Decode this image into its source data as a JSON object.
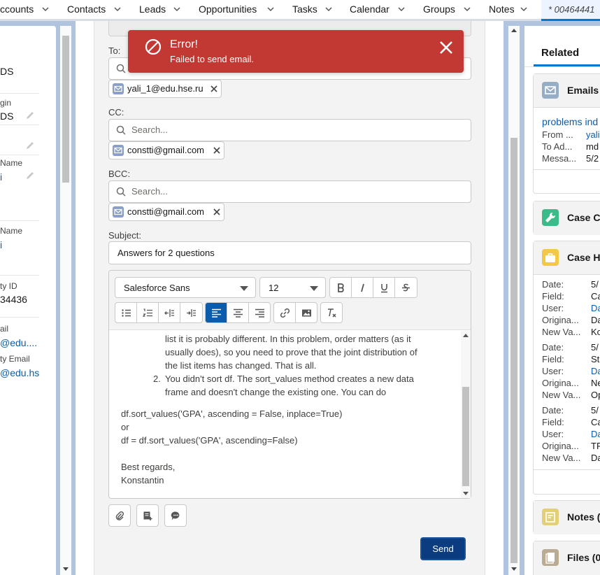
{
  "nav": {
    "items": [
      "ccounts",
      "Contacts",
      "Leads",
      "Opportunities",
      "Tasks",
      "Calendar",
      "Groups",
      "Notes"
    ],
    "active_tab": "* 00464441"
  },
  "left_panel": {
    "val_top": "DS",
    "label_login": "gin",
    "val_login": "DS",
    "label_name": "Name",
    "link_name": "i",
    "label_name2": "Name",
    "link_name2": "i",
    "label_id": "ty ID",
    "val_id": "34436",
    "label_email": "ail",
    "link_email": "@edu....",
    "label_email2": "ty Email",
    "link_email2": "@edu.hs"
  },
  "email": {
    "to_label": "To:",
    "cc_label": "CC:",
    "bcc_label": "BCC:",
    "search_placeholder": "Search...",
    "to_pill": "yali_1@edu.hse.ru",
    "cc_pill": "constti@gmail.com",
    "bcc_pill": "constti@gmail.com",
    "subject_label": "Subject:",
    "subject_value": "Answers for 2 questions",
    "font_family": "Salesforce Sans",
    "font_size": "12",
    "body": {
      "line1": "list it is probably different. In this problem, order matters (as it",
      "line2": "usually does), so you need to prove that the joint distribution of",
      "line3": "the list items has changed. That is all.",
      "item2_num": "2.",
      "line4": "You didn't sort df. The sort_values method creates a new data",
      "line5": "frame and doesn't change the existing one. You can do",
      "code1": "df.sort_values('GPA', ascending = False, inplace=True)",
      "or": "or",
      "code2": "df = df.sort_values('GPA', ascending=False)",
      "regards": "Best regards,",
      "name": "Konstantin"
    },
    "send_label": "Send"
  },
  "toast": {
    "title": "Error!",
    "message": "Failed to send email."
  },
  "right_panel": {
    "tab": "Related",
    "emails_title": "Emails",
    "email_link": "problems ind",
    "email_rows": [
      {
        "k": "From ...",
        "v": "yali"
      },
      {
        "k": "To Ad...",
        "v": "md"
      },
      {
        "k": "Messa...",
        "v": "5/2"
      }
    ],
    "case_comments_title": "Case Co",
    "case_history_title": "Case H",
    "history": [
      {
        "date": "5/",
        "field": "Ca",
        "user": "Da",
        "orig": "Da",
        "newv": "Ko"
      },
      {
        "date": "5/",
        "field": "Sta",
        "user": "Da",
        "orig": "Ne",
        "newv": "Op"
      },
      {
        "date": "5/",
        "field": "Ca",
        "user": "Da",
        "orig": "TF",
        "newv": "Da"
      }
    ],
    "history_labels": {
      "date": "Date:",
      "field": "Field:",
      "user": "User:",
      "orig": "Origina...",
      "newv": "New Va..."
    },
    "notes_title": "Notes (",
    "files_title": "Files (0"
  }
}
